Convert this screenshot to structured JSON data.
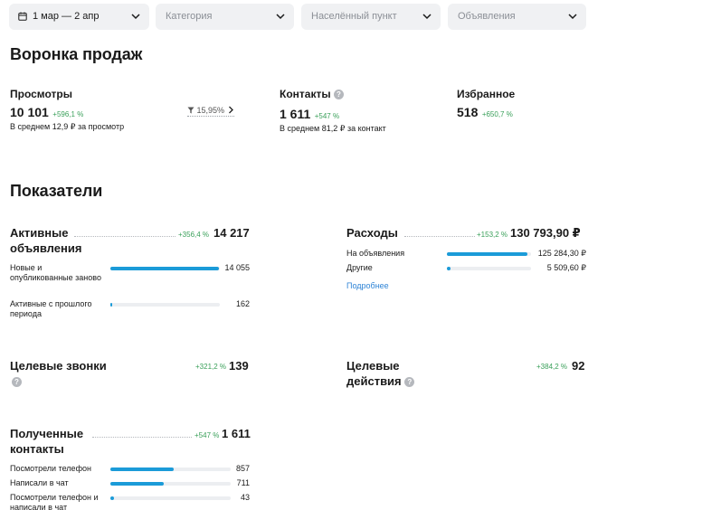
{
  "filters": {
    "date": "1 мар — 2 апр",
    "category": "Категория",
    "city": "Населённый пункт",
    "ads": "Объявления"
  },
  "funnel": {
    "title": "Воронка продаж",
    "views": {
      "label": "Просмотры",
      "value": "10 101",
      "change": "+596,1 %",
      "note": "В среднем 12,9 ₽ за просмотр"
    },
    "conversion": "15,95%",
    "contacts": {
      "label": "Контакты",
      "value": "1 611",
      "change": "+547 %",
      "note": "В среднем 81,2 ₽ за контакт"
    },
    "favorites": {
      "label": "Избранное",
      "value": "518",
      "change": "+650,7 %"
    }
  },
  "indicators": {
    "title": "Показатели",
    "active": {
      "title": "Активные объявления",
      "change": "+356,4 %",
      "value": "14 217",
      "rows": [
        {
          "label": "Новые и опубликованные заново",
          "value": "14 055",
          "share": 0.99
        },
        {
          "label": "Активные с прошлого периода",
          "value": "162",
          "share": 0.02
        }
      ]
    },
    "expenses": {
      "title": "Расходы",
      "change": "+153,2 %",
      "value": "130 793,90 ₽",
      "rows": [
        {
          "label": "На объявления",
          "value": "125 284,30 ₽",
          "share": 0.96
        },
        {
          "label": "Другие",
          "value": "5 509,60 ₽",
          "share": 0.04
        }
      ],
      "more": "Подробнее"
    },
    "calls": {
      "title": "Целевые звонки",
      "change": "+321,2 %",
      "value": "139"
    },
    "actions": {
      "title": "Целевые действия",
      "change": "+384,2 %",
      "value": "92"
    },
    "received": {
      "title": "Полученные контакты",
      "change": "+547 %",
      "value": "1 611",
      "rows": [
        {
          "label": "Посмотрели телефон",
          "value": "857",
          "share": 0.53
        },
        {
          "label": "Написали в чат",
          "value": "711",
          "share": 0.44
        },
        {
          "label": "Посмотрели телефон и написали в чат",
          "value": "43",
          "share": 0.03
        }
      ]
    }
  },
  "colors": {
    "accent": "#1b9bd8",
    "positive": "#3aa05a",
    "link": "#2f84d6",
    "filter_bg": "#f0f1f3"
  },
  "icons": [
    "calendar-icon",
    "chevron-down-icon",
    "funnel-icon",
    "chevron-right-icon",
    "help-icon"
  ]
}
